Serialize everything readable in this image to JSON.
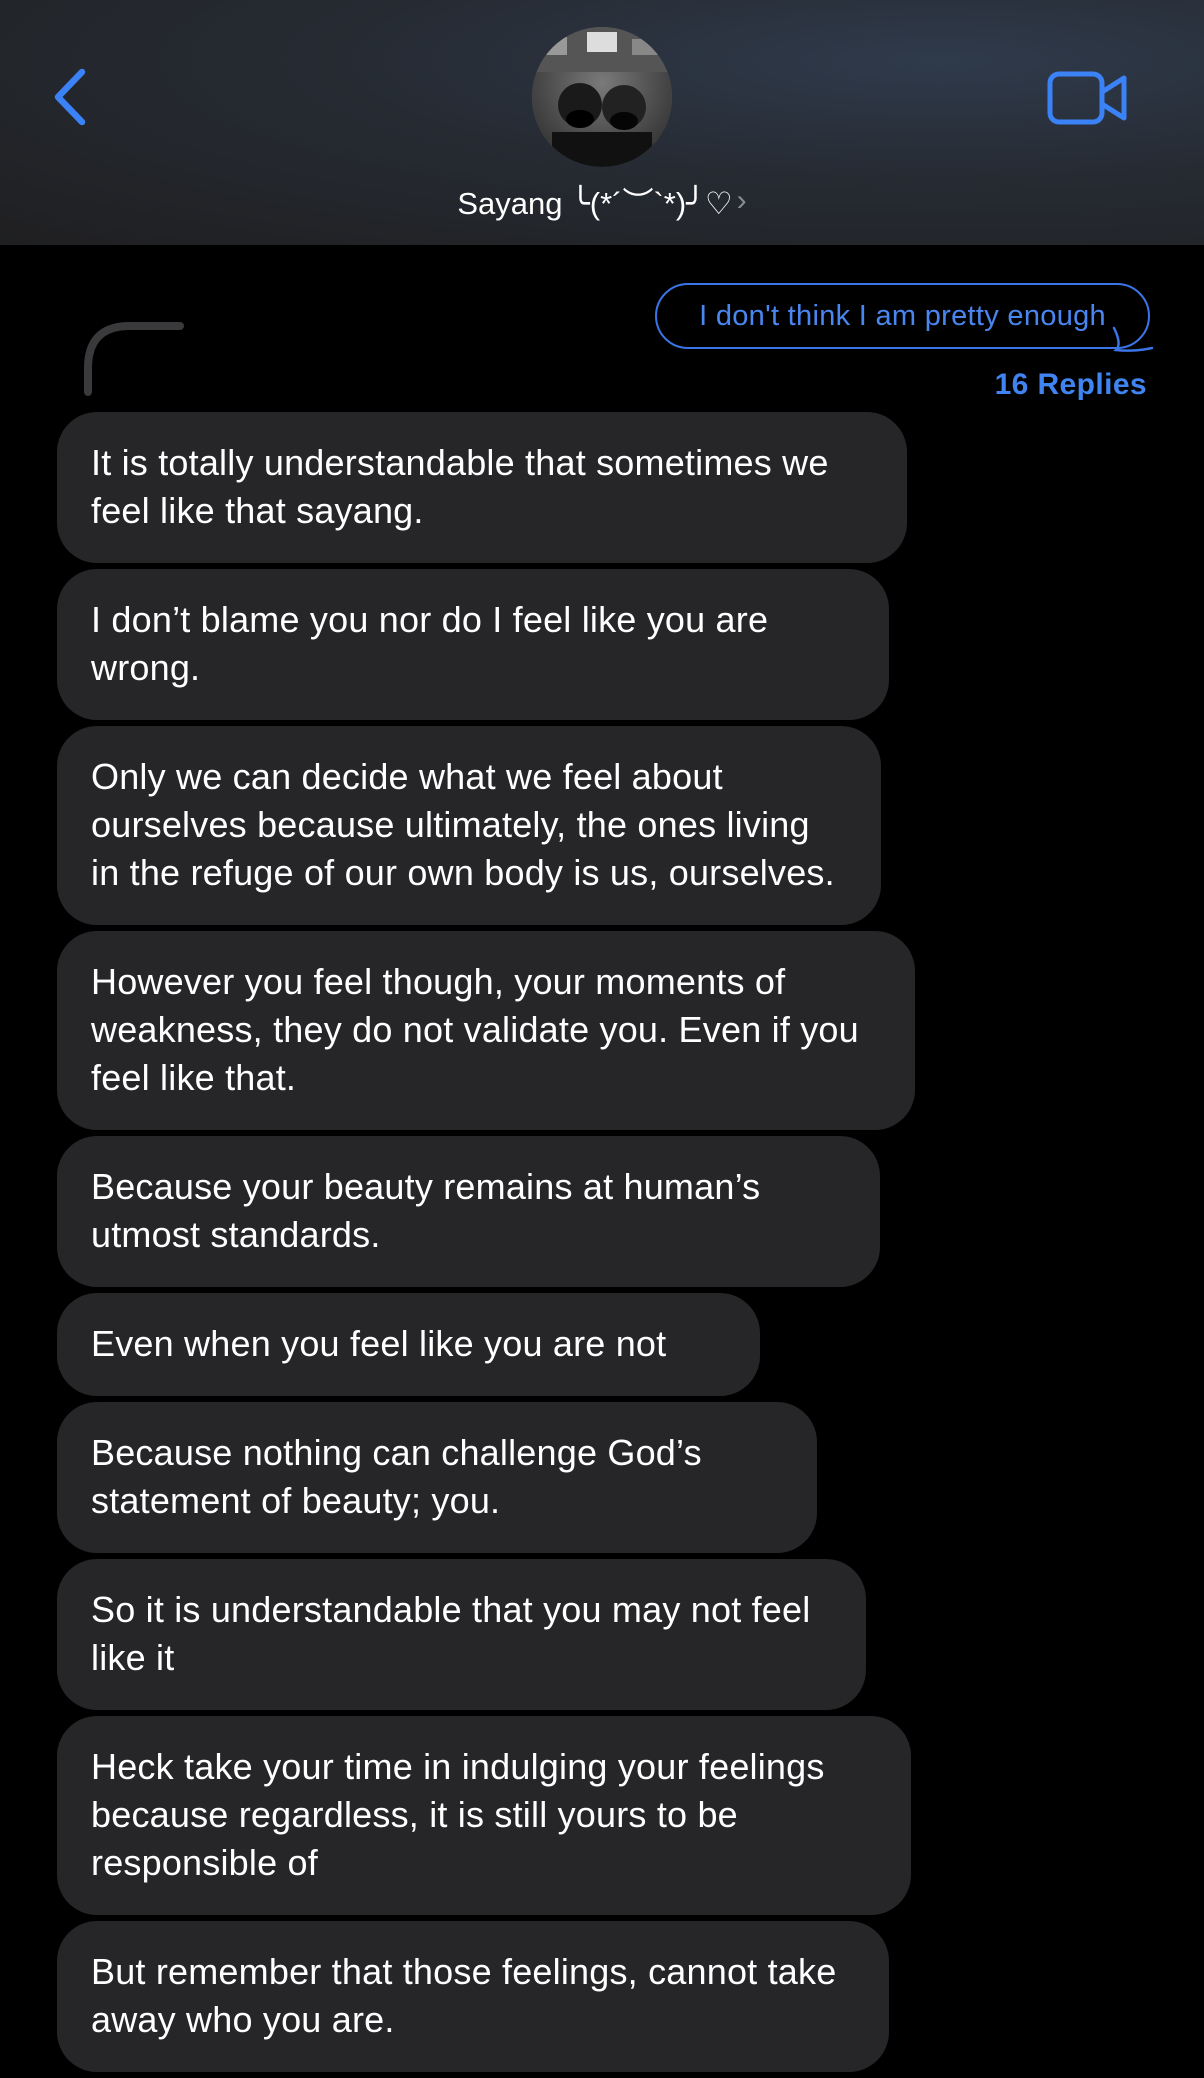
{
  "header": {
    "contact_name": "Sayang ╰(*´︶`*)╯♡",
    "chevron": "›",
    "back_icon": "chevron-left-icon",
    "video_icon": "video-camera-icon",
    "accent_color": "#3b82f6"
  },
  "thread": {
    "quoted_message": "I don't think I am pretty enough",
    "replies_label": "16 Replies"
  },
  "messages": [
    "It is totally understandable that sometimes we feel like that sayang.",
    "I don’t blame you nor do I feel like you are wrong.",
    "Only we can decide what we feel about ourselves because ultimately, the ones living in the refuge of our own body is us, ourselves.",
    "However you feel though, your moments of weakness, they do not validate you. Even if you feel like that.",
    "Because your beauty remains at human’s utmost standards.",
    "Even when you feel like you are not",
    "Because nothing can challenge God’s statement of beauty; you.",
    "So it is understandable that you may not feel like it",
    "Heck take your time in indulging your feelings because regardless, it is still yours to be responsible of",
    "But remember that those feelings, cannot take away who you are."
  ]
}
